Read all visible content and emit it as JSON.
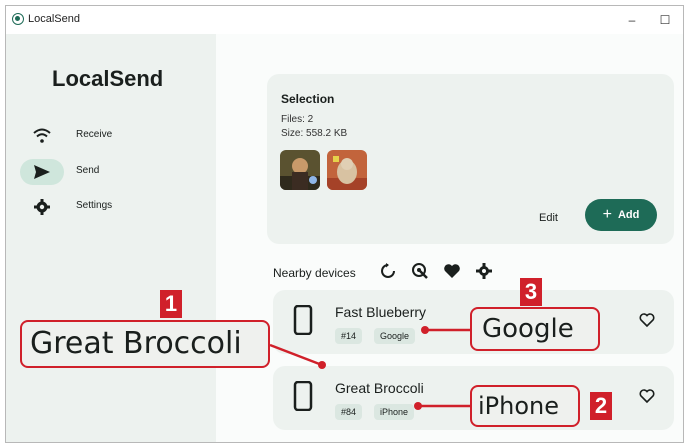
{
  "window": {
    "title": "LocalSend",
    "minimize_glyph": "–",
    "maximize_glyph": "☐"
  },
  "sidebar": {
    "brand": "LocalSend",
    "items": [
      {
        "label": "Receive",
        "icon": "wifi-icon",
        "active": false
      },
      {
        "label": "Send",
        "icon": "send-icon",
        "active": true
      },
      {
        "label": "Settings",
        "icon": "gear-icon",
        "active": false
      }
    ]
  },
  "selection": {
    "title": "Selection",
    "files": "Files: 2",
    "size": "Size: 558.2 KB",
    "edit_label": "Edit",
    "add_label": "Add"
  },
  "nearby": {
    "label": "Nearby devices",
    "devices": [
      {
        "name": "Fast Blueberry",
        "id": "#14",
        "platform": "Google"
      },
      {
        "name": "Great Broccoli",
        "id": "#84",
        "platform": "iPhone"
      }
    ]
  },
  "annotations": {
    "callout_1_text": "Great Broccoli",
    "callout_1_num": "1",
    "callout_2_text": "iPhone",
    "callout_2_num": "2",
    "callout_3_text": "Google",
    "callout_3_num": "3",
    "accent_color": "#d0202a"
  },
  "colors": {
    "primary": "#1e6b57",
    "card_bg": "#edf2ef",
    "nav_active": "#cfe6dc"
  }
}
